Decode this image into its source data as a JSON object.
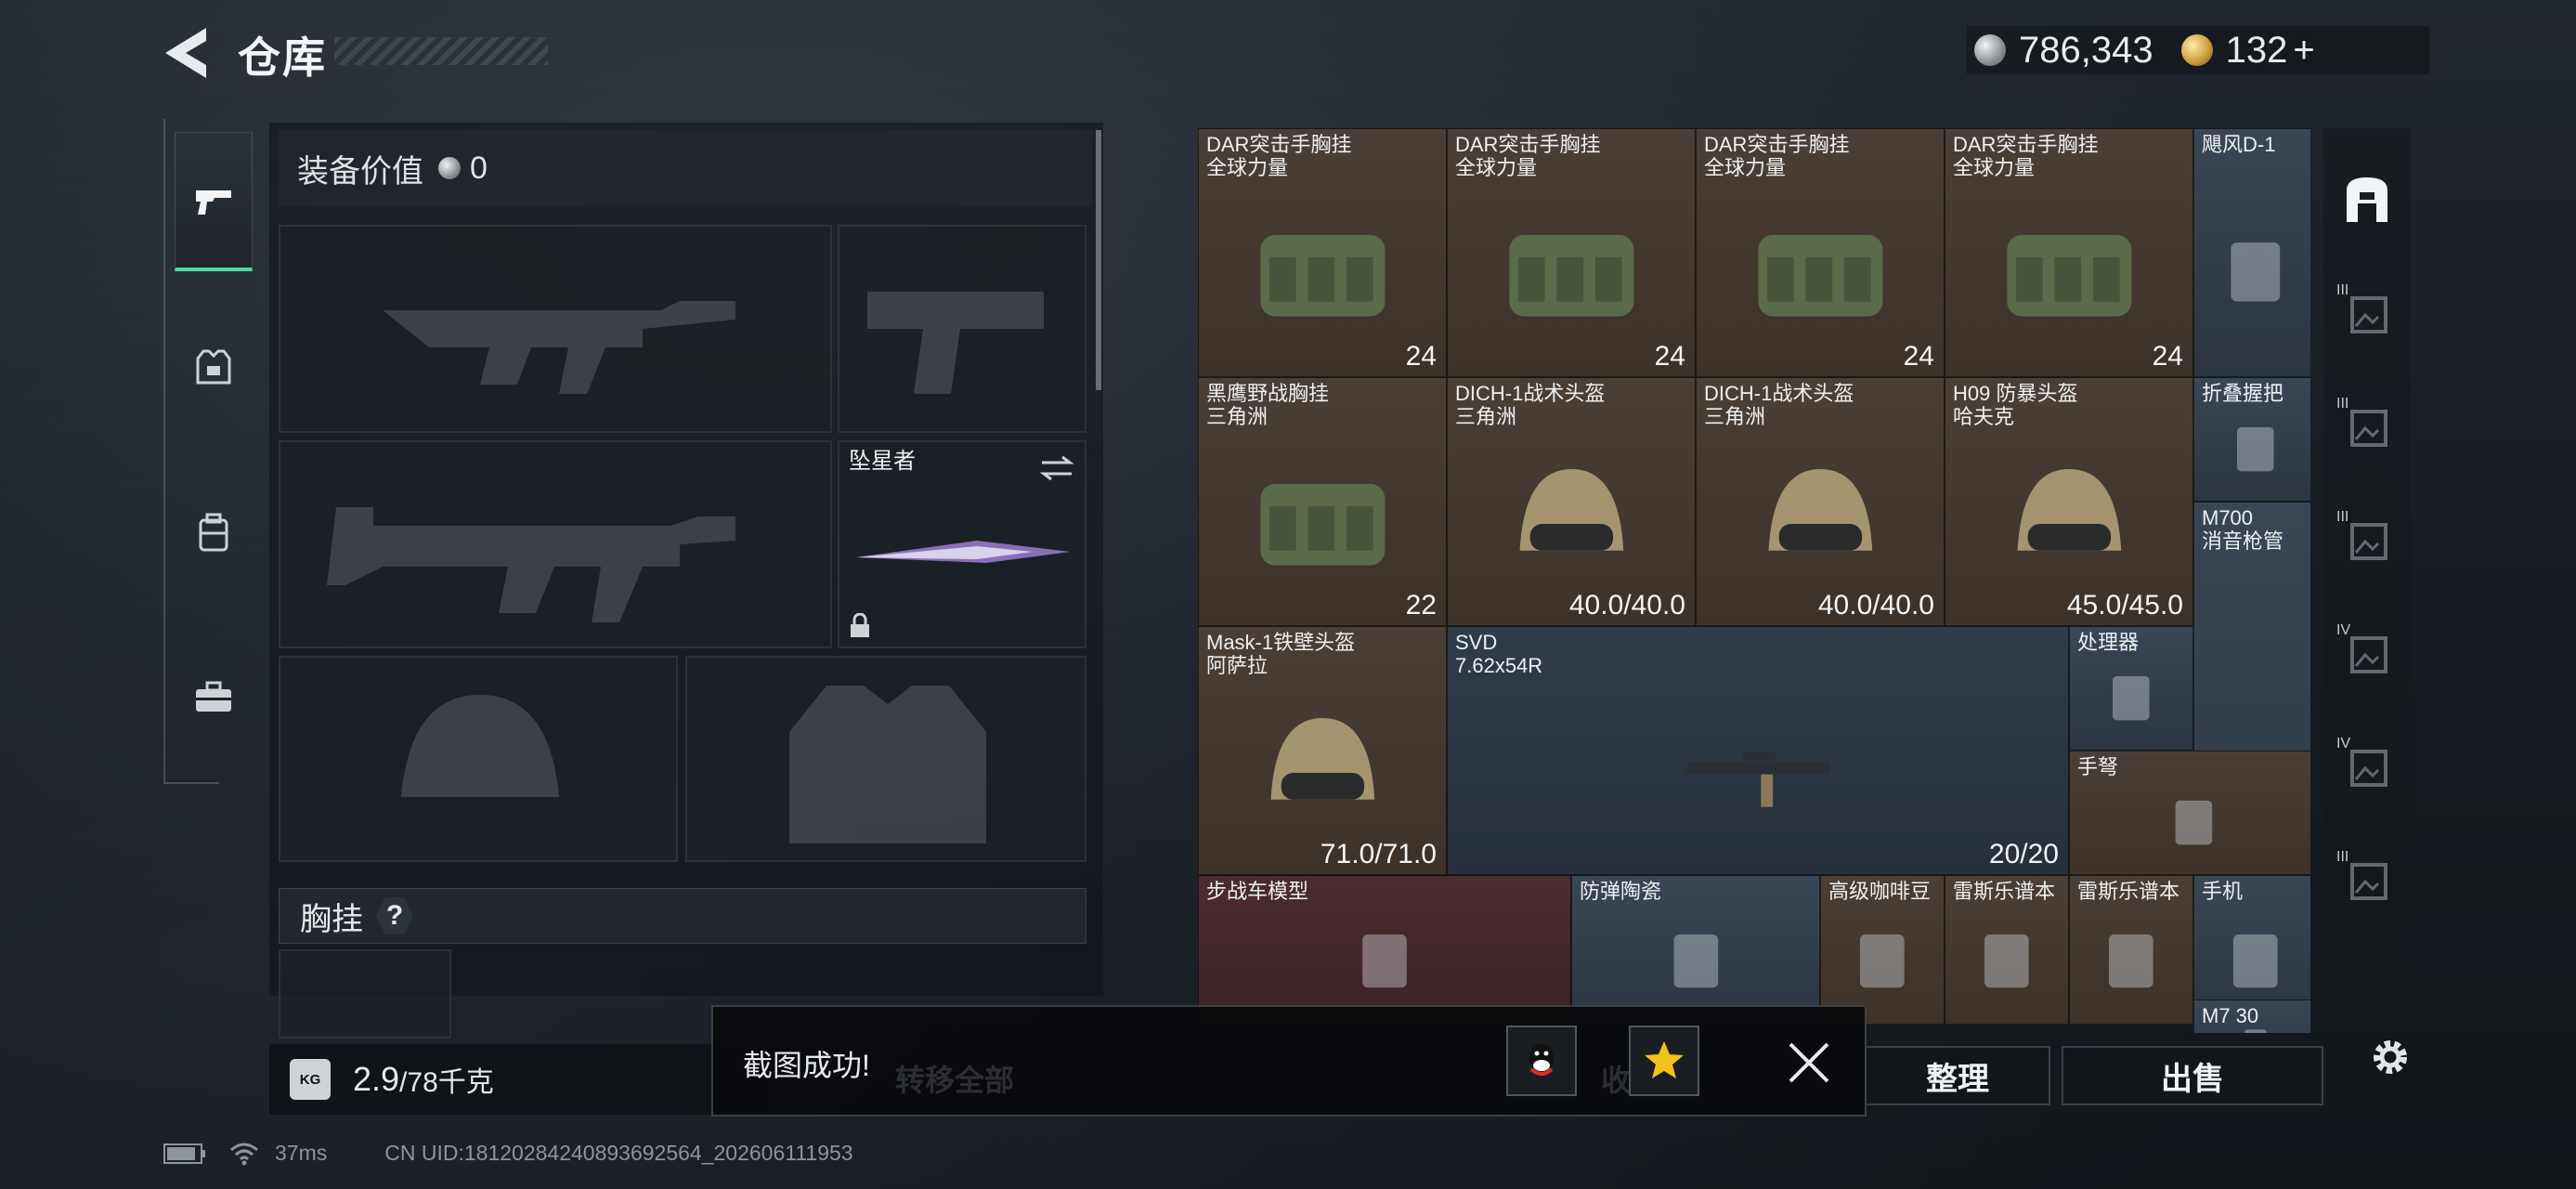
{
  "header": {
    "title": "仓库"
  },
  "currency": {
    "silver": "786,343",
    "gold": "132",
    "gold_plus": "+"
  },
  "loadout": {
    "value_label": "装备价值",
    "value": "0",
    "melee_name": "坠星者",
    "chest_label": "胸挂",
    "chest_help": "?",
    "weight_current": "2.9",
    "weight_max": "/78千克",
    "kg_badge": "KG"
  },
  "grid_items": [
    {
      "name": "DAR突击手胸挂\n全球力量",
      "qty": "24",
      "bg": "brown"
    },
    {
      "name": "DAR突击手胸挂\n全球力量",
      "qty": "24",
      "bg": "brown"
    },
    {
      "name": "DAR突击手胸挂\n全球力量",
      "qty": "24",
      "bg": "brown"
    },
    {
      "name": "DAR突击手胸挂\n全球力量",
      "qty": "24",
      "bg": "brown"
    },
    {
      "name": "飓风D-1",
      "qty": "",
      "bg": "blue"
    },
    {
      "name": "黑鹰野战胸挂\n三角洲",
      "qty": "22",
      "bg": "brown"
    },
    {
      "name": "DICH-1战术头盔\n三角洲",
      "qty": "40.0/40.0",
      "bg": "brown"
    },
    {
      "name": "DICH-1战术头盔\n三角洲",
      "qty": "40.0/40.0",
      "bg": "brown"
    },
    {
      "name": "H09 防暴头盔\n哈夫克",
      "qty": "45.0/45.0",
      "bg": "brown"
    },
    {
      "name": "折叠握把",
      "qty": "",
      "bg": "blue"
    },
    {
      "name": "M700\n消音枪管",
      "qty": "",
      "bg": "blue"
    },
    {
      "name": "Mask-1铁壁头盔\n阿萨拉",
      "qty": "71.0/71.0",
      "bg": "brown"
    },
    {
      "name": "SVD\n7.62x54R",
      "qty": "20/20",
      "bg": "dark"
    },
    {
      "name": "处理器",
      "qty": "",
      "bg": "blue"
    },
    {
      "name": "手弩",
      "qty": "",
      "bg": "brown"
    },
    {
      "name": "步战车模型",
      "qty": "",
      "bg": "red"
    },
    {
      "name": "防弹陶瓷",
      "qty": "",
      "bg": "blue"
    },
    {
      "name": "高级咖啡豆",
      "qty": "",
      "bg": "brown"
    },
    {
      "name": "雷斯乐谱本",
      "qty": "",
      "bg": "brown"
    },
    {
      "name": "雷斯乐谱本",
      "qty": "",
      "bg": "brown"
    },
    {
      "name": "手机",
      "qty": "",
      "bg": "blue"
    },
    {
      "name": "M7 30",
      "qty": "",
      "bg": "blue"
    }
  ],
  "right_nav": [
    {
      "icon": "warehouse-icon",
      "label": ""
    },
    {
      "icon": "storage-tab-icon",
      "label": "III"
    },
    {
      "icon": "storage-tab-icon",
      "label": "III"
    },
    {
      "icon": "storage-tab-icon",
      "label": "III"
    },
    {
      "icon": "storage-add-icon",
      "label": "IV"
    },
    {
      "icon": "storage-add-icon",
      "label": "IV"
    },
    {
      "icon": "storage-tab-icon",
      "label": "III"
    }
  ],
  "buttons": {
    "organize": "整理",
    "sell": "出售",
    "transfer_all": "转移全部",
    "favorites": "收藏"
  },
  "toast": {
    "message": "截图成功!"
  },
  "status": {
    "ping": "37ms",
    "uid": "CN UID:1812028424089369256​4_202606111953"
  },
  "colors": {
    "accent": "#4fd8a2",
    "panel": "#1c2127"
  }
}
